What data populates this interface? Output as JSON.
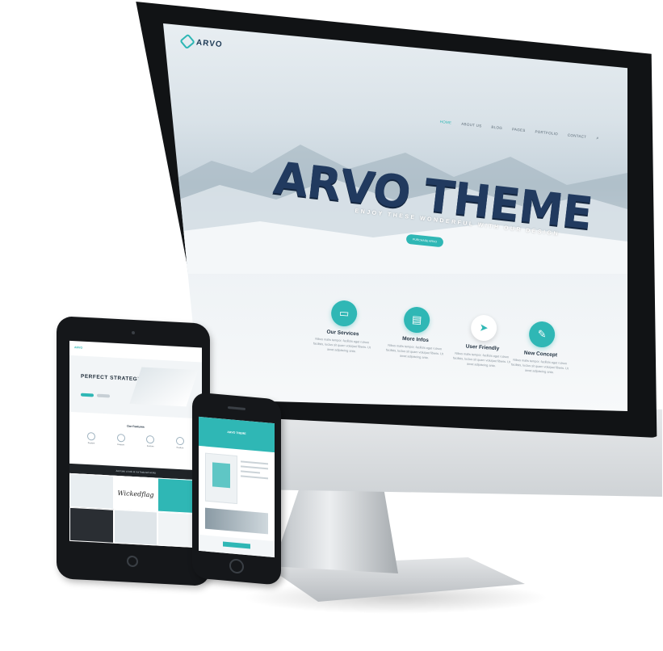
{
  "desktop": {
    "logo_text": "ARVO",
    "nav": [
      "Home",
      "About Us",
      "Blog",
      "Pages",
      "Portfolio",
      "Contact"
    ],
    "search_glyph": "⌕",
    "hero_title": "ARVO THEME",
    "hero_subtitle": "ENJOY THESE WONDERFUL WITH OUR DESIGN",
    "hero_button": "Purchase Arvo",
    "features": [
      {
        "title": "Our Services",
        "text": "Nibus malis tempor, facilisis eget rutrum facilisis, luctus sit quam volutpat fiberis. Ut amet adipiscing ante.",
        "icon": "monitor-icon",
        "glyph": "▭",
        "color": "#2fb7b5"
      },
      {
        "title": "More Infos",
        "text": "Nibus malis tempor, facilisis eget rutrum facilisis, luctus sit quam volutpat fiberis. Ut amet adipiscing ante.",
        "icon": "folder-icon",
        "glyph": "▤",
        "color": "#2fb7b5"
      },
      {
        "title": "User Friendly",
        "text": "Nibus malis tempor, facilisis eget rutrum facilisis, luctus sit quam volutpat fiberis. Ut amet adipiscing ante.",
        "icon": "send-icon",
        "glyph": "➤",
        "color": "#ffffff"
      },
      {
        "title": "New Concept",
        "text": "Nibus malis tempor, facilisis eget rutrum facilisis, luctus sit quam volutpat fiberis. Ut amet adipiscing ante.",
        "icon": "pencil-icon",
        "glyph": "✎",
        "color": "#2fb7b5"
      }
    ]
  },
  "tablet": {
    "logo_text": "ARVO",
    "hero_title": "PERFECT STRATEGY",
    "section_title": "Our Features",
    "icon_labels": [
      "Feature",
      "Feature",
      "Feature",
      "Feature"
    ],
    "dark_band_text": "Just take a look at our featured works",
    "script_tile": "Wickedflag"
  },
  "phone": {
    "hero_text": "ARVO THEME"
  },
  "colors": {
    "accent": "#2fb7b5",
    "title_navy": "#213a5f",
    "device_black": "#15171a",
    "aluminum": "#cfd3d6"
  }
}
